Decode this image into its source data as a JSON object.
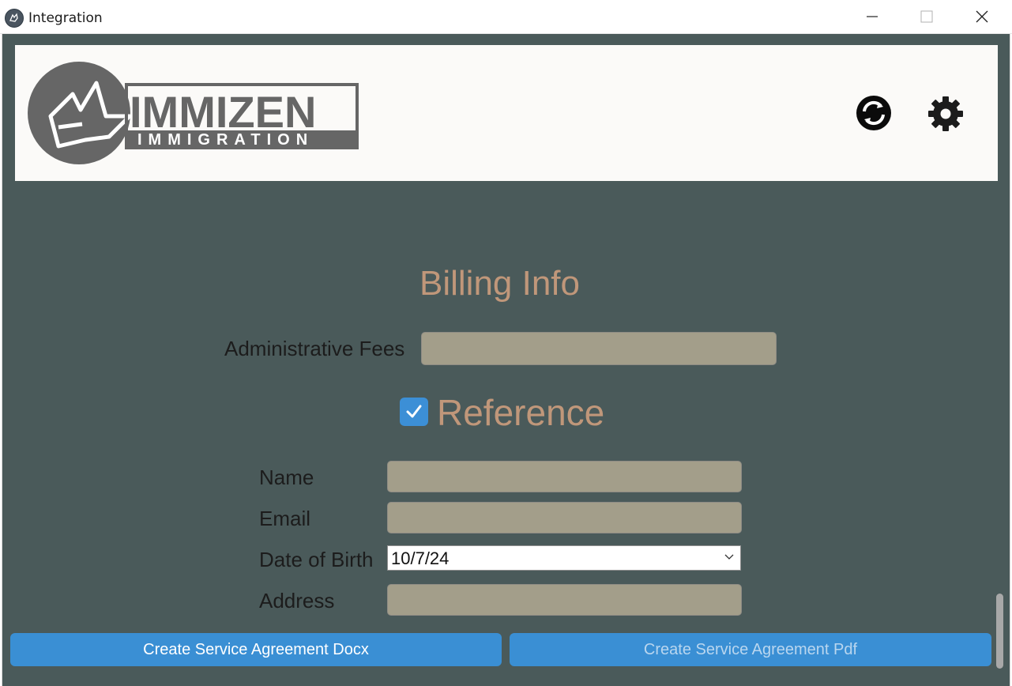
{
  "window": {
    "title": "Integration"
  },
  "header": {
    "logo_text_main": "IMMIZEN",
    "logo_text_sub": "IMMIGRATION"
  },
  "billing": {
    "title": "Billing Info",
    "admin_fees_label": "Administrative Fees",
    "admin_fees_value": ""
  },
  "reference": {
    "title": "Reference",
    "checked": true,
    "name_label": "Name",
    "name_value": "",
    "email_label": "Email",
    "email_value": "",
    "dob_label": "Date of Birth",
    "dob_value": "10/7/24",
    "address_label": "Address",
    "address_value": ""
  },
  "actions": {
    "docx_label": "Create Service Agreement Docx",
    "pdf_label": "Create Service Agreement Pdf"
  },
  "colors": {
    "background": "#4a5a5a",
    "accent_title": "#c0977a",
    "button": "#3a8fd4",
    "field": "#a39e8a"
  },
  "icons": {
    "sync": "sync-icon",
    "settings": "gear-icon"
  }
}
